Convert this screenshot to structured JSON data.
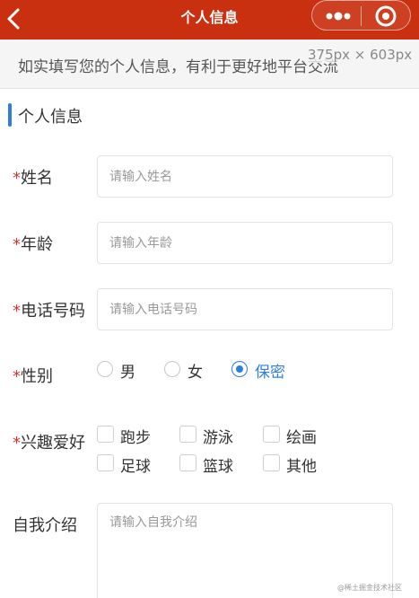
{
  "navbar": {
    "title": "个人信息",
    "background": "#c9300f"
  },
  "notice": {
    "text": "如实填写您的个人信息，有利于更好地平台交流",
    "size_overlay": "375px × 603px"
  },
  "section": {
    "title": "个人信息",
    "accent": "#2f7de1"
  },
  "form": {
    "required_mark": "*",
    "name": {
      "label": "姓名",
      "placeholder": "请输入姓名",
      "value": ""
    },
    "age": {
      "label": "年龄",
      "placeholder": "请输入年龄",
      "value": ""
    },
    "phone": {
      "label": "电话号码",
      "placeholder": "请输入电话号码",
      "value": ""
    },
    "gender": {
      "label": "性别",
      "options": [
        "男",
        "女",
        "保密"
      ],
      "selected": "保密"
    },
    "hobbies": {
      "label": "兴趣爱好",
      "options": [
        "跑步",
        "游泳",
        "绘画",
        "足球",
        "篮球",
        "其他"
      ],
      "checked": []
    },
    "intro": {
      "label": "自我介绍",
      "placeholder": "请输入自我介绍",
      "value": ""
    }
  },
  "icons": {
    "back": "chevron-left-icon",
    "menu": "more-dots-icon",
    "close": "target-circle-icon"
  },
  "watermark": "@稀土掘金技术社区"
}
